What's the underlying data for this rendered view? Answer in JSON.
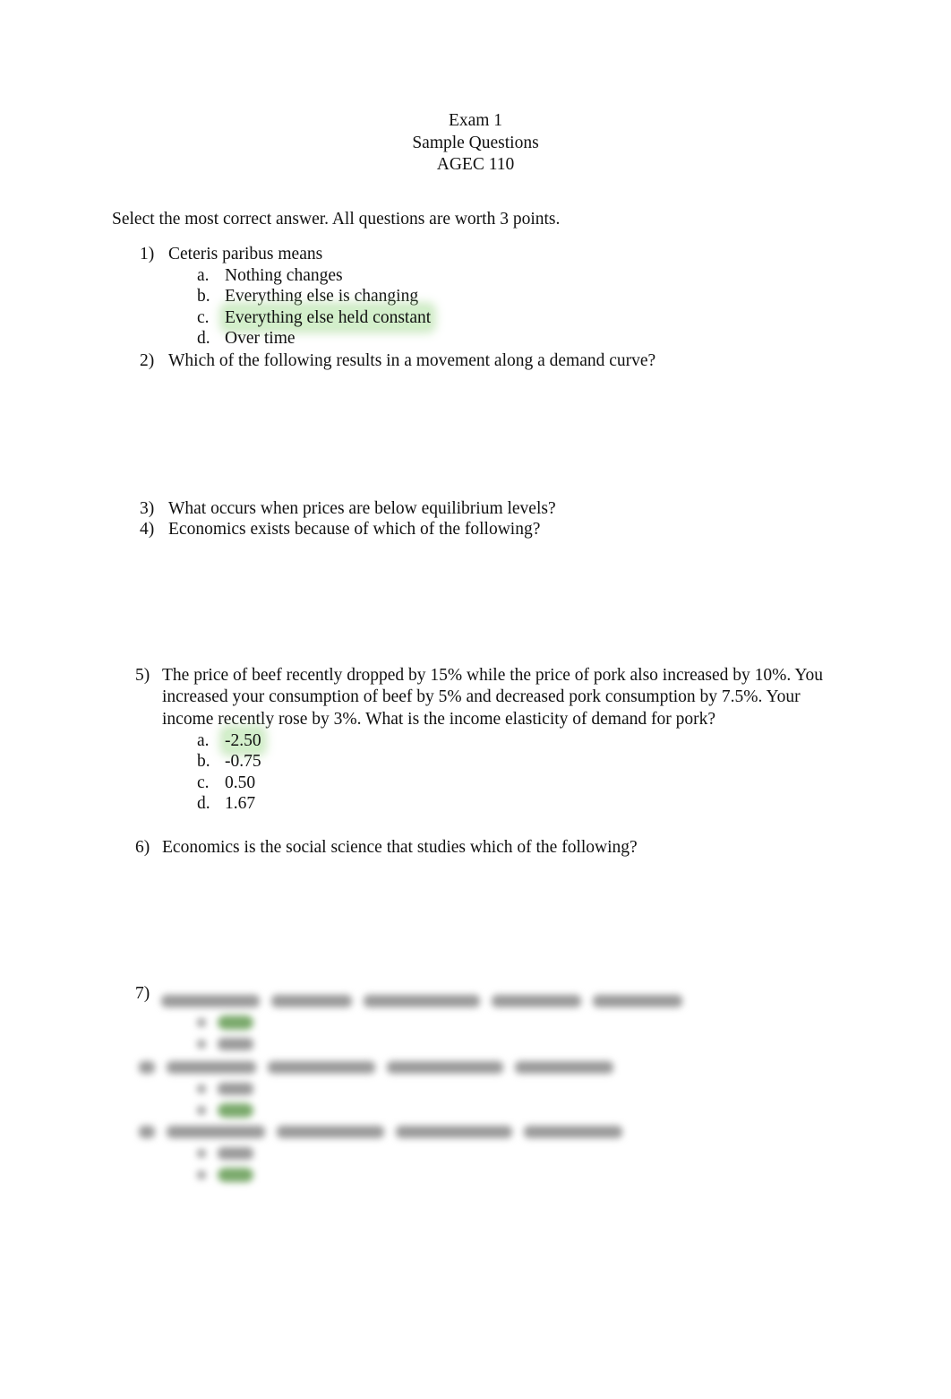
{
  "header": {
    "line1": "Exam 1",
    "line2": "Sample Questions",
    "line3": "AGEC 110"
  },
  "instructions": "Select the most correct answer. All questions are worth 3 points.",
  "highlight_color": "#afe1a0",
  "questions": [
    {
      "number": "1)",
      "text": "Ceteris paribus  means",
      "options": [
        {
          "letter": "a.",
          "text": "Nothing changes",
          "highlighted": false
        },
        {
          "letter": "b.",
          "text": "Everything else is changing",
          "highlighted": false
        },
        {
          "letter": "c.",
          "text": "Everything else held constant",
          "highlighted": true
        },
        {
          "letter": "d.",
          "text": "Over time",
          "highlighted": false
        }
      ]
    },
    {
      "number": "2)",
      "text": "Which of the following results in a movement along a demand curve?"
    },
    {
      "number": "3)",
      "text": "What occurs when prices are below equilibrium levels?"
    },
    {
      "number": "4)",
      "text": "Economics exists because of which of the following?"
    },
    {
      "number": "5)",
      "text": "The price of beef recently dropped by 15% while the price of pork also increased by 10%. You increased your consumption of beef by 5% and decreased pork consumption by 7.5%. Your income recently rose by 3%. What is the income elasticity of demand for pork?",
      "options": [
        {
          "letter": "a.",
          "text": "-2.50",
          "highlighted": true
        },
        {
          "letter": "b.",
          "text": "-0.75",
          "highlighted": false
        },
        {
          "letter": "c.",
          "text": "0.50",
          "highlighted": false
        },
        {
          "letter": "d.",
          "text": "1.67",
          "highlighted": false
        }
      ]
    },
    {
      "number": "6)",
      "text": "Economics is the social science that studies which of the following?"
    },
    {
      "number": "7)",
      "text": "[blurred]",
      "blurred": true
    }
  ]
}
